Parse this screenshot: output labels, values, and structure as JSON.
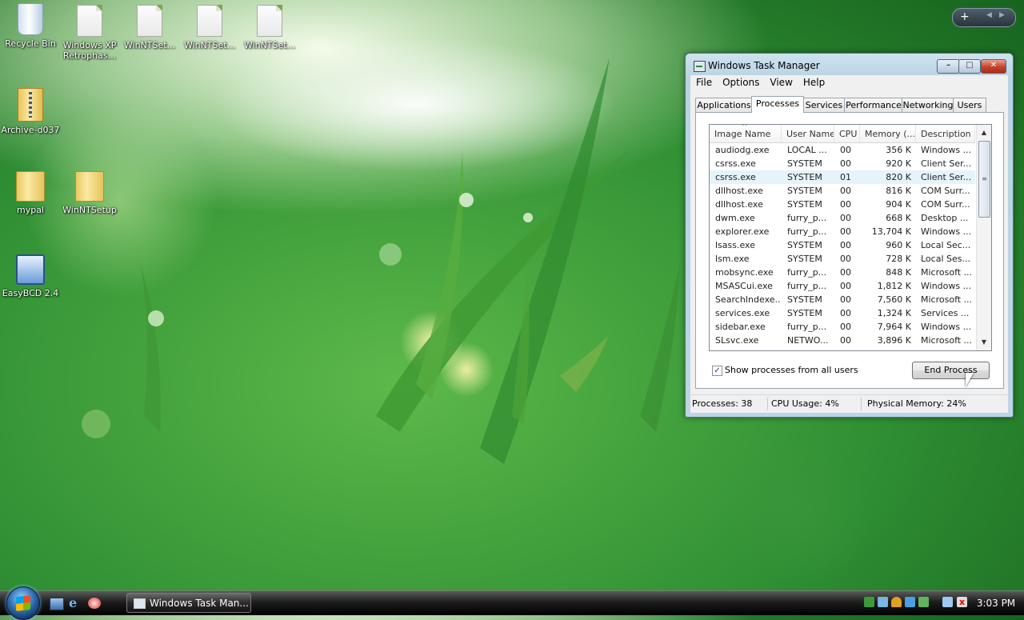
{
  "desktop": {
    "icons": [
      {
        "label": "Recycle Bin"
      },
      {
        "label": "Windows XP Retrophas..."
      },
      {
        "label": "WinNTSet..."
      },
      {
        "label": "WinNTSet..."
      },
      {
        "label": "WinNTSet..."
      },
      {
        "label": "Archive-d037"
      },
      {
        "label": "mypal"
      },
      {
        "label": "WinNTSetup"
      },
      {
        "label": "EasyBCD 2.4"
      }
    ]
  },
  "window": {
    "title": "Windows Task Manager",
    "menu": [
      "File",
      "Options",
      "View",
      "Help"
    ],
    "tabs": [
      "Applications",
      "Processes",
      "Services",
      "Performance",
      "Networking",
      "Users"
    ],
    "active_tab": "Processes",
    "columns": [
      "Image Name",
      "User Name",
      "CPU",
      "Memory (...",
      "Description"
    ],
    "sorted_column": "Image Name",
    "processes": [
      {
        "name": "audiodg.exe",
        "user": "LOCAL ...",
        "cpu": "00",
        "mem": "356 K",
        "desc": "Windows ..."
      },
      {
        "name": "csrss.exe",
        "user": "SYSTEM",
        "cpu": "00",
        "mem": "920 K",
        "desc": "Client Ser..."
      },
      {
        "name": "csrss.exe",
        "user": "SYSTEM",
        "cpu": "01",
        "mem": "820 K",
        "desc": "Client Ser...",
        "selected": true
      },
      {
        "name": "dllhost.exe",
        "user": "SYSTEM",
        "cpu": "00",
        "mem": "816 K",
        "desc": "COM Surr..."
      },
      {
        "name": "dllhost.exe",
        "user": "SYSTEM",
        "cpu": "00",
        "mem": "904 K",
        "desc": "COM Surr..."
      },
      {
        "name": "dwm.exe",
        "user": "furry_p...",
        "cpu": "00",
        "mem": "668 K",
        "desc": "Desktop ..."
      },
      {
        "name": "explorer.exe",
        "user": "furry_p...",
        "cpu": "00",
        "mem": "13,704 K",
        "desc": "Windows ..."
      },
      {
        "name": "lsass.exe",
        "user": "SYSTEM",
        "cpu": "00",
        "mem": "960 K",
        "desc": "Local Sec..."
      },
      {
        "name": "lsm.exe",
        "user": "SYSTEM",
        "cpu": "00",
        "mem": "728 K",
        "desc": "Local Ses..."
      },
      {
        "name": "mobsync.exe",
        "user": "furry_p...",
        "cpu": "00",
        "mem": "848 K",
        "desc": "Microsoft ..."
      },
      {
        "name": "MSASCui.exe",
        "user": "furry_p...",
        "cpu": "00",
        "mem": "1,812 K",
        "desc": "Windows ..."
      },
      {
        "name": "SearchIndexe...",
        "user": "SYSTEM",
        "cpu": "00",
        "mem": "7,560 K",
        "desc": "Microsoft ..."
      },
      {
        "name": "services.exe",
        "user": "SYSTEM",
        "cpu": "00",
        "mem": "1,324 K",
        "desc": "Services ..."
      },
      {
        "name": "sidebar.exe",
        "user": "furry_p...",
        "cpu": "00",
        "mem": "7,964 K",
        "desc": "Windows ..."
      },
      {
        "name": "SLsvc.exe",
        "user": "NETWO...",
        "cpu": "00",
        "mem": "3,896 K",
        "desc": "Microsoft ..."
      }
    ],
    "show_all_users": {
      "label": "Show processes from all users",
      "checked": true
    },
    "end_process_label": "End Process",
    "status": {
      "processes": "Processes: 38",
      "cpu": "CPU Usage: 4%",
      "memory": "Physical Memory: 24%"
    }
  },
  "taskbar": {
    "task_button_label": "Windows Task Man...",
    "clock": "3:03 PM"
  }
}
